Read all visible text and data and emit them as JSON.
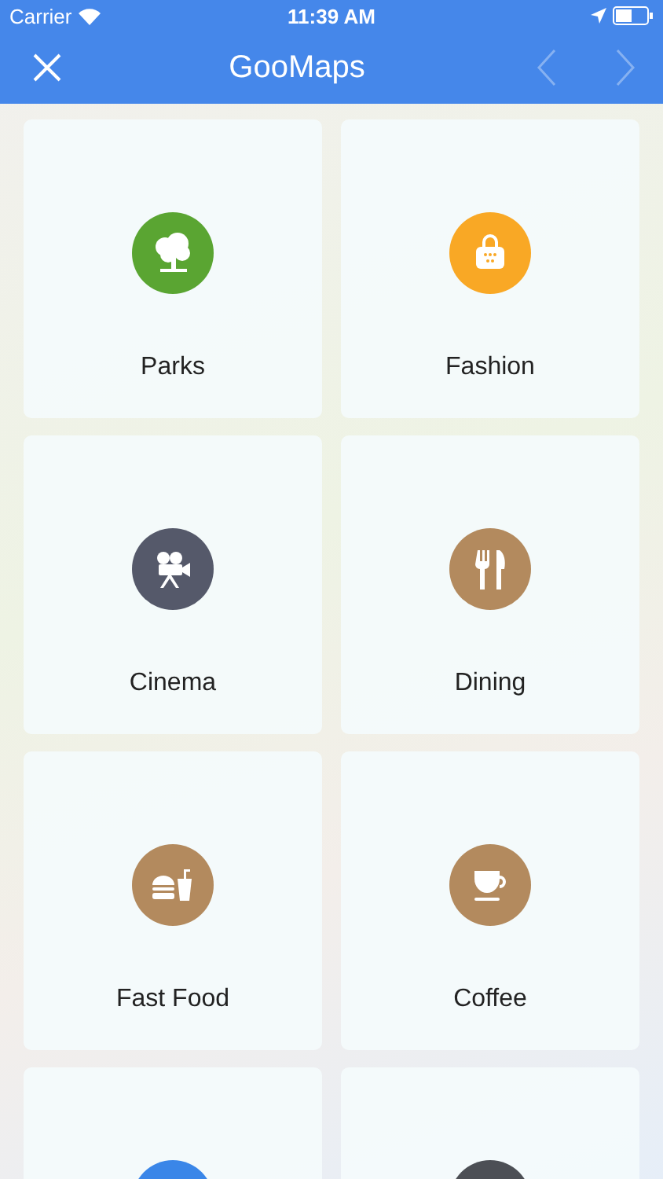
{
  "status_bar": {
    "carrier": "Carrier",
    "time": "11:39 AM"
  },
  "nav_bar": {
    "title": "GooMaps",
    "back": {
      "disabled": true
    },
    "forward": {
      "disabled": true
    }
  },
  "categories": [
    {
      "label": "Parks",
      "color": "#5aa532"
    },
    {
      "label": "Fashion",
      "color": "#f9a825"
    },
    {
      "label": "Cinema",
      "color": "#55596a"
    },
    {
      "label": "Dining",
      "color": "#b38a5e"
    },
    {
      "label": "Fast Food",
      "color": "#b38a5e"
    },
    {
      "label": "Coffee",
      "color": "#b38a5e"
    },
    {
      "color": "#3a86e8"
    },
    {
      "color": "#4c4f55"
    }
  ]
}
